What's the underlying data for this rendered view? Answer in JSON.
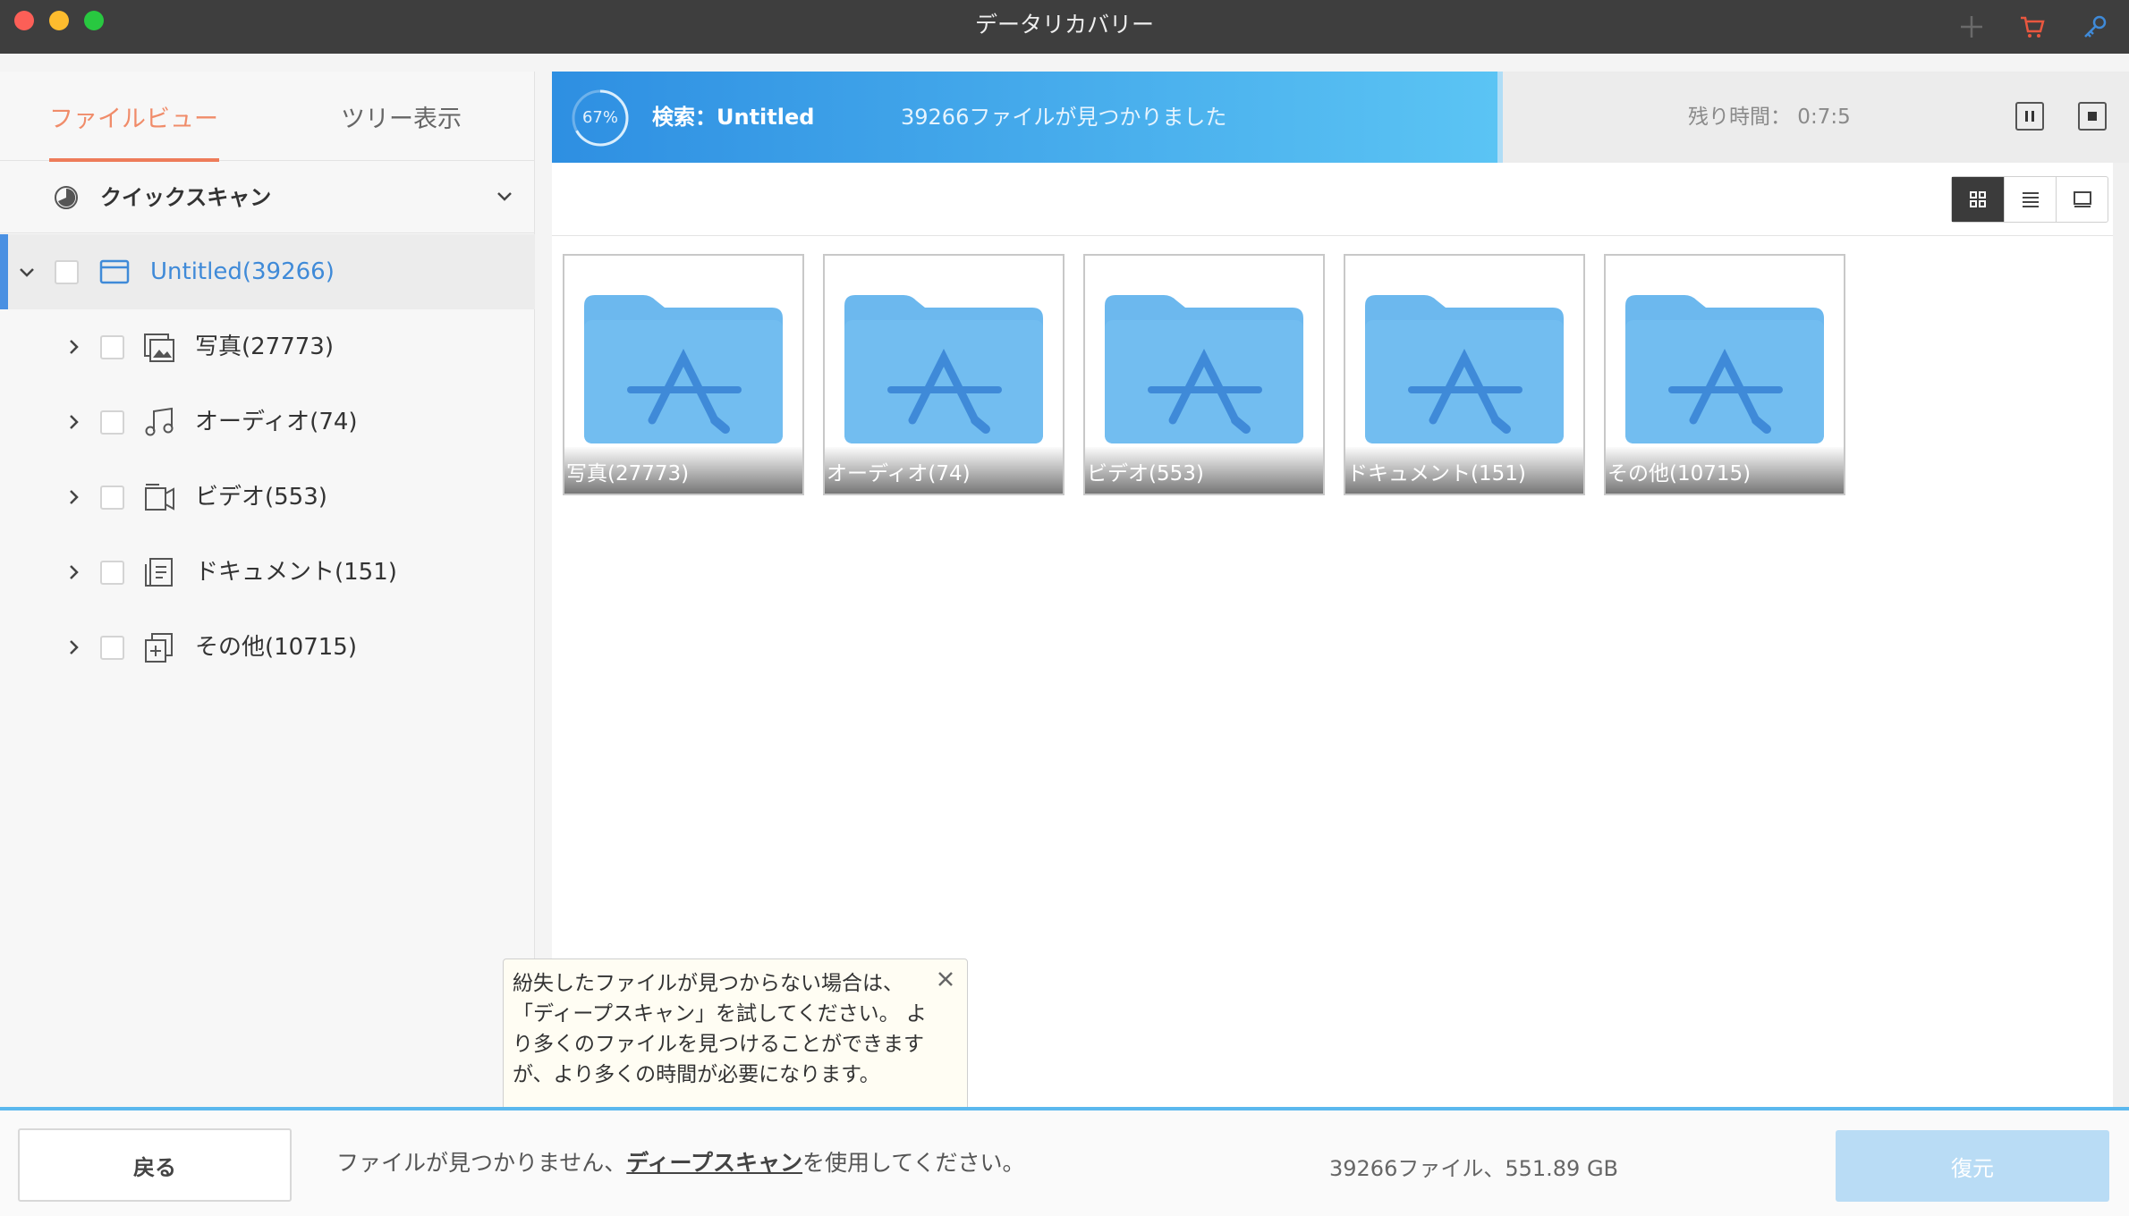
{
  "window": {
    "title": "データリカバリー"
  },
  "sidebar": {
    "tabs": [
      {
        "label": "ファイルビュー",
        "active": true
      },
      {
        "label": "ツリー表示",
        "active": false
      }
    ],
    "scan_type": "クイックスキャン",
    "root": {
      "label": "Untitled(39266)"
    },
    "items": [
      {
        "label": "写真(27773)",
        "icon": "image-icon"
      },
      {
        "label": "オーディオ(74)",
        "icon": "music-icon"
      },
      {
        "label": "ビデオ(553)",
        "icon": "video-icon"
      },
      {
        "label": "ドキュメント(151)",
        "icon": "document-icon"
      },
      {
        "label": "その他(10715)",
        "icon": "other-files-icon"
      }
    ]
  },
  "progress": {
    "percent_label": "67%",
    "percent": 67,
    "search_label": "検索：Untitled",
    "found_label": "39266ファイルが見つかりました",
    "remaining_label": "残り時間： 0:7:5"
  },
  "folders": [
    {
      "label": "写真(27773)"
    },
    {
      "label": "オーディオ(74)"
    },
    {
      "label": "ビデオ(553)"
    },
    {
      "label": "ドキュメント(151)"
    },
    {
      "label": "その他(10715)"
    }
  ],
  "tooltip": {
    "text": "紛失したファイルが見つからない場合は、「ディープスキャン」を試してください。 より多くのファイルを見つけることができますが、より多くの時間が必要になります。"
  },
  "bottom": {
    "back_label": "戻る",
    "msg_prefix": "ファイルが見つかりません、",
    "msg_link": "ディープスキャン",
    "msg_suffix": "を使用してください。",
    "stats": "39266ファイル、551.89 GB",
    "recover_label": "復元"
  },
  "colors": {
    "accent_orange": "#ee7c5a",
    "accent_blue": "#4a90e2",
    "folder_blue": "#6cb8ee"
  }
}
